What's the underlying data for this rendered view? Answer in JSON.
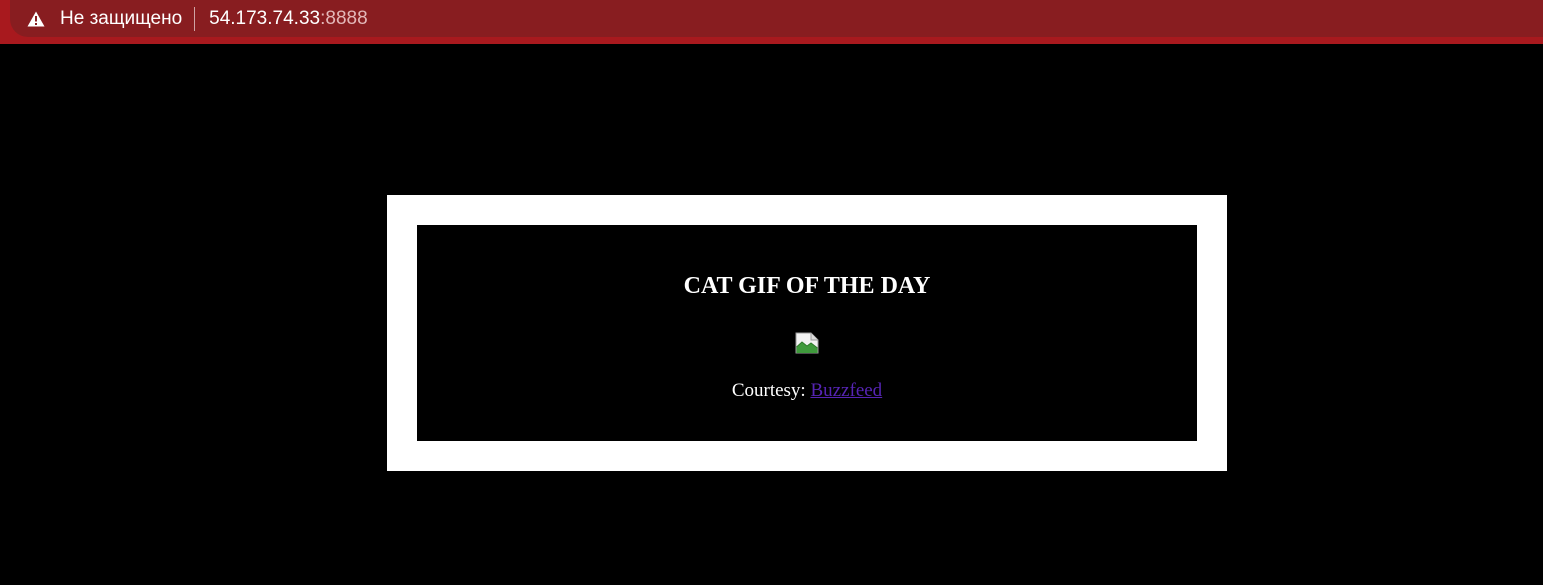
{
  "browser": {
    "security_label": "Не защищено",
    "url_host": "54.173.74.33",
    "url_port": ":8888",
    "warning_icon": "warning-triangle-icon",
    "bar_color": "#a8191e"
  },
  "page": {
    "title": "CAT GIF OF THE DAY",
    "image_icon": "broken-image-icon",
    "courtesy_label": "Courtesy:",
    "courtesy_link_text": "Buzzfeed",
    "background": "#000000",
    "frame_color": "#ffffff",
    "link_color": "#5624b3"
  }
}
